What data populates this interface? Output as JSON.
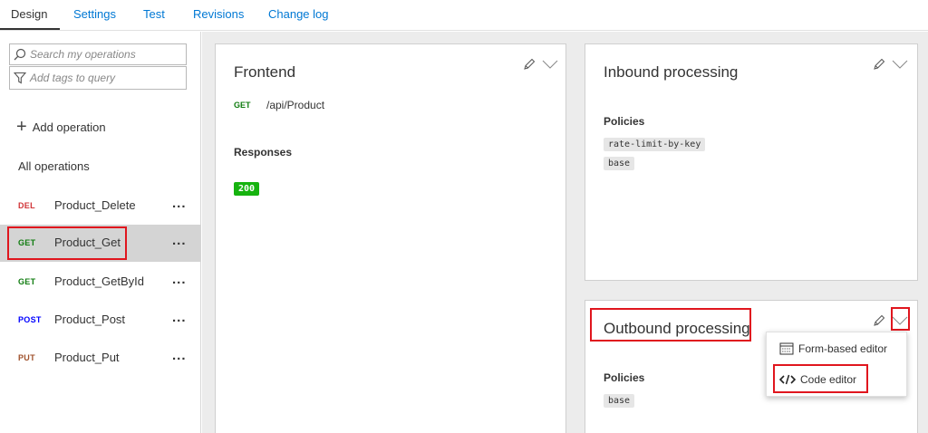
{
  "tabs": [
    {
      "label": "Design",
      "active": true
    },
    {
      "label": "Settings",
      "active": false
    },
    {
      "label": "Test",
      "active": false
    },
    {
      "label": "Revisions",
      "active": false
    },
    {
      "label": "Change log",
      "active": false
    }
  ],
  "sidebar": {
    "search_placeholder": "Search my operations",
    "tags_placeholder": "Add tags to query",
    "add_operation": "Add operation",
    "all_operations": "All operations",
    "operations": [
      {
        "verb": "DEL",
        "name": "Product_Delete",
        "verb_color": "#d13438",
        "selected": false
      },
      {
        "verb": "GET",
        "name": "Product_Get",
        "verb_color": "#107c10",
        "selected": true
      },
      {
        "verb": "GET",
        "name": "Product_GetById",
        "verb_color": "#107c10",
        "selected": false
      },
      {
        "verb": "POST",
        "name": "Product_Post",
        "verb_color": "#0000ff",
        "selected": false
      },
      {
        "verb": "PUT",
        "name": "Product_Put",
        "verb_color": "#a0522d",
        "selected": false
      }
    ],
    "more_label": "..."
  },
  "frontend": {
    "title": "Frontend",
    "method": "GET",
    "path": "/api/Product",
    "responses_label": "Responses",
    "response_code": "200"
  },
  "inbound": {
    "title": "Inbound processing",
    "policies_label": "Policies",
    "policies": [
      "rate-limit-by-key",
      "base"
    ]
  },
  "outbound": {
    "title": "Outbound processing",
    "policies_label": "Policies",
    "policies": [
      "base"
    ]
  },
  "menu": {
    "form_editor": "Form-based editor",
    "code_editor": "Code editor"
  },
  "colors": {
    "accent": "#0078d4",
    "highlight": "#e0161e",
    "status_ok": "#16b30f"
  }
}
